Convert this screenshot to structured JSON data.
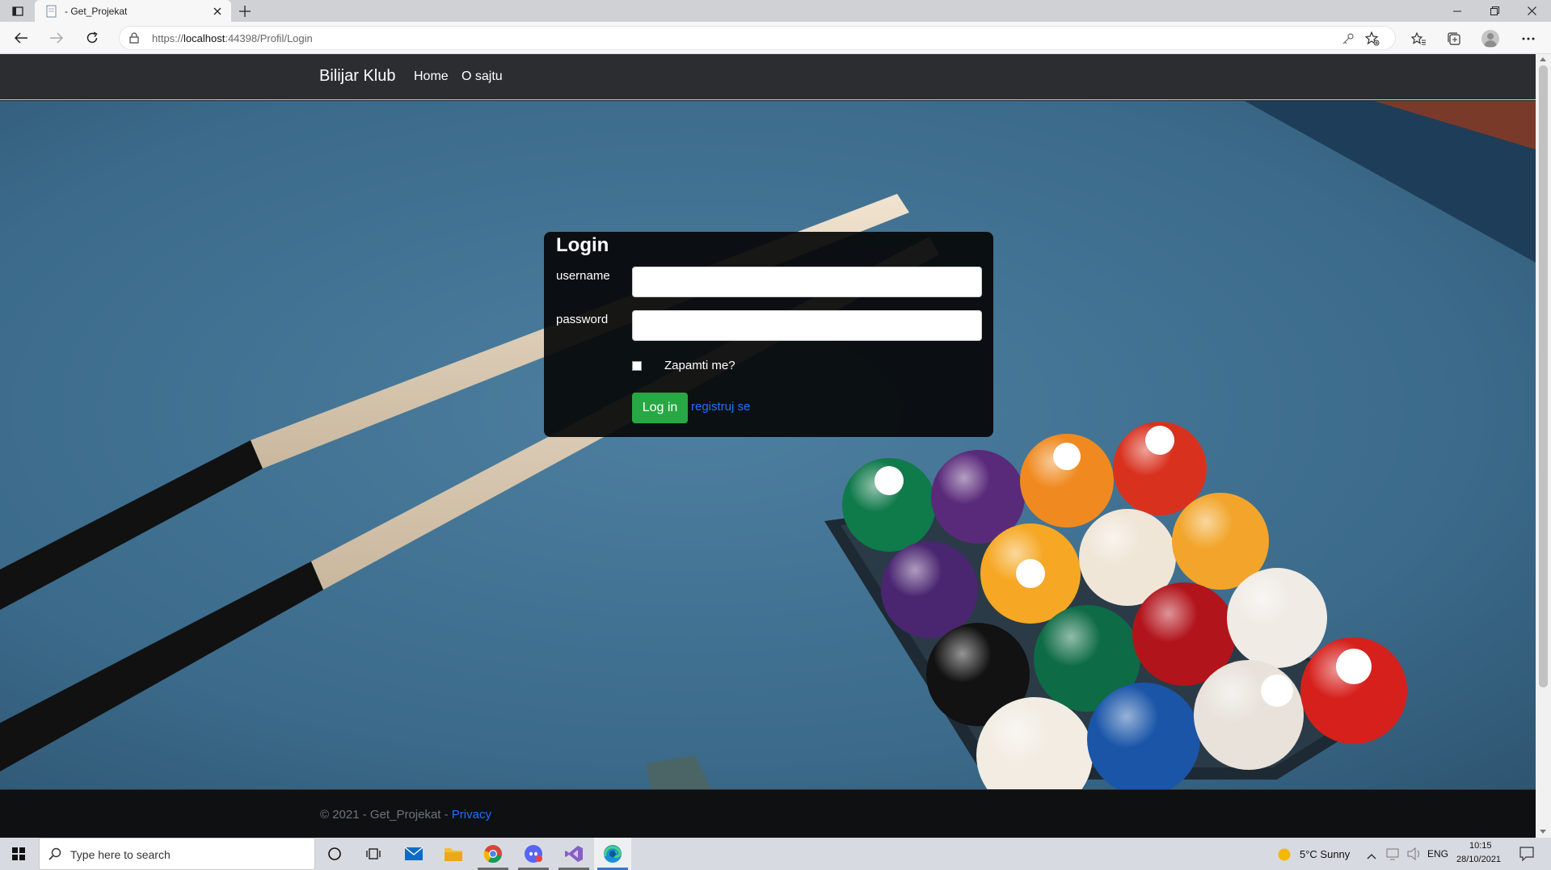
{
  "browser": {
    "tab_title": " - Get_Projekat",
    "url_prefix": "https://",
    "url_host": "localhost",
    "url_rest": ":44398/Profil/Login"
  },
  "site": {
    "brand": "Bilijar Klub",
    "nav": [
      "Home",
      "O sajtu"
    ]
  },
  "login": {
    "title": "Login",
    "username_label": "username",
    "password_label": "password",
    "username_value": "",
    "password_value": "",
    "remember_label": "Zapamti me?",
    "remember_checked": false,
    "submit_label": "Log in",
    "register_link": "registruj se"
  },
  "footer": {
    "copyright": "© 2021 - Get_Projekat - ",
    "privacy": "Privacy"
  },
  "taskbar": {
    "search_placeholder": "Type here to search",
    "weather": "5°C  Sunny",
    "language": "ENG",
    "time": "10:15",
    "date": "28/10/2021"
  },
  "colors": {
    "navbar": "#2b2d31",
    "table_felt": "#3f6f8f",
    "login_button": "#28a745",
    "link": "#1f6fff"
  }
}
